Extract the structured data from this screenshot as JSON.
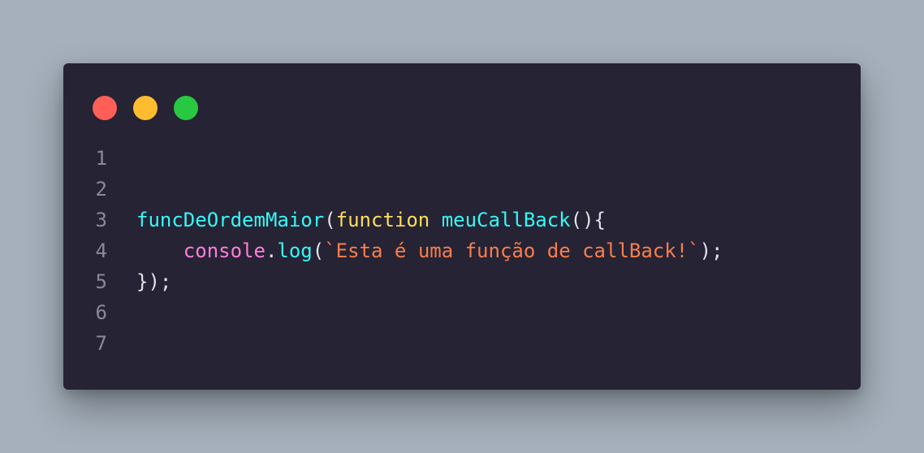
{
  "colors": {
    "background": "#a5b0bc",
    "editor_bg": "#262335",
    "dot_red": "#ff5f57",
    "dot_yellow": "#febc2e",
    "dot_green": "#28c840",
    "token_function_name": "#36f9f6",
    "token_keyword": "#fede5d",
    "token_plain": "#e2e2ea",
    "token_object": "#ff7edb",
    "token_string": "#f97e4a",
    "line_number": "#8b8a98"
  },
  "window_controls": [
    {
      "name": "close",
      "color": "#ff5f57"
    },
    {
      "name": "minimize",
      "color": "#febc2e"
    },
    {
      "name": "maximize",
      "color": "#28c840"
    }
  ],
  "lines": [
    {
      "number": "1",
      "tokens": []
    },
    {
      "number": "2",
      "tokens": []
    },
    {
      "number": "3",
      "tokens": [
        {
          "text": "funcDeOrdemMaior",
          "kind": "function_name"
        },
        {
          "text": "(",
          "kind": "plain"
        },
        {
          "text": "function",
          "kind": "keyword"
        },
        {
          "text": " ",
          "kind": "plain"
        },
        {
          "text": "meuCallBack",
          "kind": "function_name"
        },
        {
          "text": "(){",
          "kind": "plain"
        }
      ]
    },
    {
      "number": "4",
      "tokens": [
        {
          "text": "    ",
          "kind": "plain"
        },
        {
          "text": "console",
          "kind": "object"
        },
        {
          "text": ".",
          "kind": "plain"
        },
        {
          "text": "log",
          "kind": "function_name"
        },
        {
          "text": "(",
          "kind": "plain"
        },
        {
          "text": "`Esta é uma função de callBack!`",
          "kind": "string"
        },
        {
          "text": ");",
          "kind": "plain"
        }
      ]
    },
    {
      "number": "5",
      "tokens": [
        {
          "text": "});",
          "kind": "plain"
        }
      ]
    },
    {
      "number": "6",
      "tokens": []
    },
    {
      "number": "7",
      "tokens": []
    }
  ]
}
